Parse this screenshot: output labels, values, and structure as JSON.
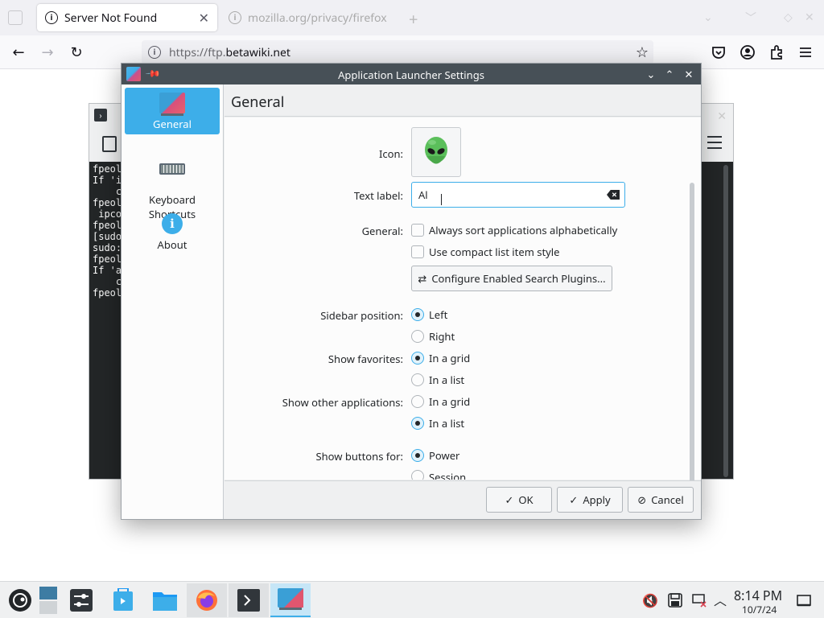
{
  "browser": {
    "active_tab_title": "Server Not Found",
    "inactive_tab_title": "mozilla.org/privacy/firefox",
    "url_scheme": "https://ftp.",
    "url_host": "betawiki.net"
  },
  "terminal": {
    "lines": "fpeol\nIf 'i\n    c\nfpeol\n ipco\nfpeol\n[sudo\nsudo:\nfpeol\nIf 'a\n    c\nfpeol"
  },
  "dialog": {
    "title": "Application Launcher Settings",
    "sidebar": [
      {
        "label": "General",
        "icon": "launcher-icon",
        "selected": true
      },
      {
        "label": "Keyboard\nShortcuts",
        "icon": "keyboard-icon",
        "selected": false
      },
      {
        "label": "About",
        "icon": "info-icon",
        "selected": false
      }
    ],
    "page_title": "General",
    "form": {
      "icon_label": "Icon:",
      "icon_name": "alien-icon",
      "text_label": "Text label:",
      "text_value": "Al",
      "general_label": "General:",
      "sort_alpha": {
        "label": "Always sort applications alphabetically",
        "checked": false
      },
      "compact_list": {
        "label": "Use compact list item style",
        "checked": false
      },
      "configure_button": "Configure Enabled Search Plugins...",
      "sidebar_position_label": "Sidebar position:",
      "sidebar_left": "Left",
      "sidebar_right": "Right",
      "sidebar_position_value": "Left",
      "favorites_label": "Show favorites:",
      "favorites_grid": "In a grid",
      "favorites_list": "In a list",
      "favorites_value": "In a grid",
      "other_apps_label": "Show other applications:",
      "other_grid": "In a grid",
      "other_list": "In a list",
      "other_apps_value": "In a list",
      "buttons_label": "Show buttons for:",
      "buttons_power": "Power",
      "buttons_session": "Session",
      "buttons_value": "Power"
    },
    "footer": {
      "ok": "OK",
      "apply": "Apply",
      "cancel": "Cancel"
    }
  },
  "taskbar": {
    "time": "8:14 PM",
    "date": "10/7/24"
  },
  "colors": {
    "accent": "#3daee9",
    "titlebar": "#475057"
  }
}
